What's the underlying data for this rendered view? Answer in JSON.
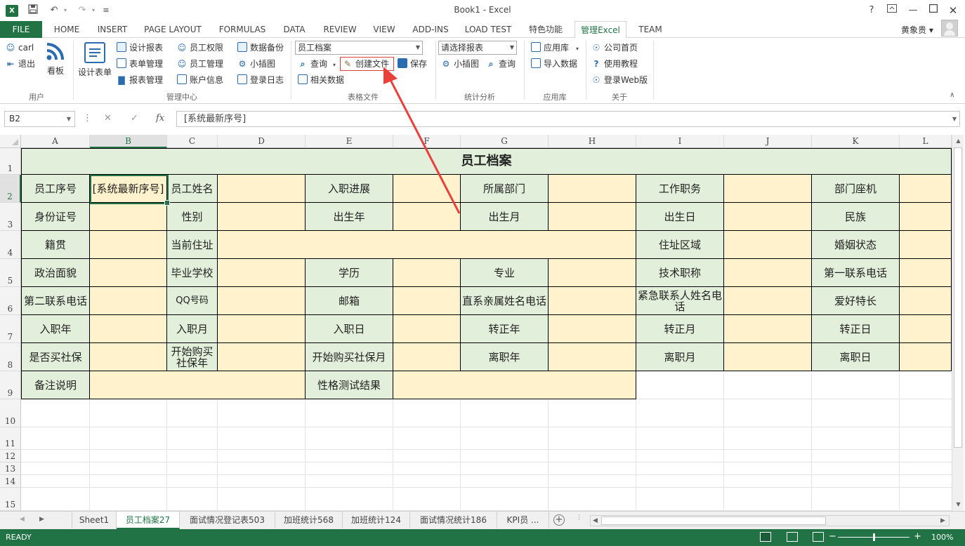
{
  "window": {
    "title": "Book1 - Excel",
    "app_icon": "X",
    "help": "?",
    "qa_dropdown": "≡"
  },
  "ribbon_tabs": [
    "FILE",
    "HOME",
    "INSERT",
    "PAGE LAYOUT",
    "FORMULAS",
    "DATA",
    "REVIEW",
    "VIEW",
    "ADD-INS",
    "LOAD TEST",
    "特色功能",
    "管理Excel",
    "TEAM"
  ],
  "active_ribbon_tab": "管理Excel",
  "user": {
    "name": "黄象贵 ▾"
  },
  "ribbon": {
    "user_group": {
      "user": "carl",
      "logout": "退出",
      "board": "看板",
      "label": "用户"
    },
    "manage_group": {
      "design_form": "设计表单",
      "design_report": "设计报表",
      "form_manage": "表单管理",
      "report_manage": "报表管理",
      "emp_perm": "员工权限",
      "emp_manage": "员工管理",
      "account_info": "账户信息",
      "data_backup": "数据备份",
      "small_chart": "小插图",
      "login_log": "登录日志",
      "label": "管理中心"
    },
    "file_group": {
      "combo": "员工档案",
      "query": "查询",
      "create_file": "创建文件",
      "save": "保存",
      "related_data": "相关数据",
      "label": "表格文件"
    },
    "stats_group": {
      "combo": "请选择报表",
      "small_chart": "小插图",
      "query": "查询",
      "label": "统计分析"
    },
    "app_group": {
      "app_store": "应用库",
      "import": "导入数据",
      "label": "应用库"
    },
    "about_group": {
      "home": "公司首页",
      "tutorial": "使用教程",
      "web": "登录Web版",
      "label": "关于"
    }
  },
  "formula_bar": {
    "name_box": "B2",
    "fx": "fx",
    "formula": "[系统最新序号]"
  },
  "columns": [
    "A",
    "B",
    "C",
    "D",
    "E",
    "F",
    "G",
    "H",
    "I",
    "J",
    "K",
    "L"
  ],
  "rows": [
    "1",
    "2",
    "3",
    "4",
    "5",
    "6",
    "7",
    "8",
    "9",
    "10",
    "11",
    "12",
    "13",
    "14",
    "15"
  ],
  "sheet": {
    "title": "员工档案",
    "r2": {
      "A": "员工序号",
      "B": "[系统最新序号]",
      "C": "员工姓名",
      "E": "入职进展",
      "G": "所属部门",
      "I": "工作职务",
      "K": "部门座机"
    },
    "r3": {
      "A": "身份证号",
      "C": "性别",
      "E": "出生年",
      "G": "出生月",
      "I": "出生日",
      "K": "民族"
    },
    "r4": {
      "A": "籍贯",
      "C": "当前住址",
      "I": "住址区域",
      "K": "婚姻状态"
    },
    "r5": {
      "A": "政治面貌",
      "C": "毕业学校",
      "E": "学历",
      "G": "专业",
      "I": "技术职称",
      "K": "第一联系电话"
    },
    "r6": {
      "A": "第二联系电话",
      "C": "QQ号码",
      "E": "邮箱",
      "G": "直系亲属姓名电话",
      "I": "紧急联系人姓名电话",
      "K": "爱好特长"
    },
    "r7": {
      "A": "入职年",
      "C": "入职月",
      "E": "入职日",
      "G": "转正年",
      "I": "转正月",
      "K": "转正日"
    },
    "r8": {
      "A": "是否买社保",
      "C": "开始购买社保年",
      "E": "开始购买社保月",
      "G": "离职年",
      "I": "离职月",
      "K": "离职日"
    },
    "r9": {
      "A": "备注说明",
      "E": "性格测试结果"
    }
  },
  "sheet_tabs": [
    "Sheet1",
    "员工档案27",
    "面试情况登记表503",
    "加班统计568",
    "加班统计124",
    "面试情况统计186",
    "KPI员 ..."
  ],
  "active_sheet_tab": "员工档案27",
  "status": {
    "text": "READY",
    "zoom": "100%",
    "zoom_level": 1.0
  },
  "colors": {
    "excel_green": "#217346",
    "label_fill": "#e2efda",
    "input_fill": "#fff2cc",
    "annotation": "#e8403a"
  }
}
